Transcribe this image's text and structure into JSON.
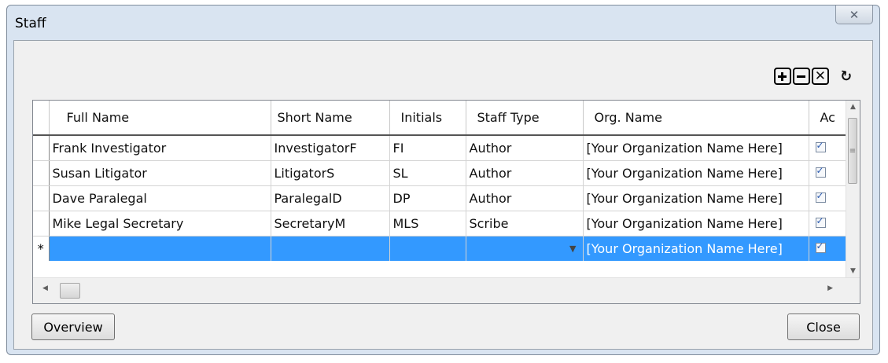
{
  "window": {
    "title": "Staff",
    "close_glyph": "✕"
  },
  "toolbar": {
    "add_icon": "plus-icon",
    "remove_icon": "minus-icon",
    "delete_icon": "x-icon",
    "refresh_icon": "refresh-icon",
    "delete_glyph": "✕",
    "refresh_glyph": "↻"
  },
  "grid": {
    "columns": [
      "Full Name",
      "Short Name",
      "Initials",
      "Staff Type",
      "Org. Name",
      "Ac"
    ],
    "rows": [
      {
        "full_name": "Frank Investigator",
        "short_name": "InvestigatorF",
        "initials": "FI",
        "staff_type": "Author",
        "org_name": "[Your Organization Name Here]",
        "active": true
      },
      {
        "full_name": "Susan Litigator",
        "short_name": "LitigatorS",
        "initials": "SL",
        "staff_type": "Author",
        "org_name": "[Your Organization Name Here]",
        "active": true
      },
      {
        "full_name": "Dave Paralegal",
        "short_name": "ParalegalD",
        "initials": "DP",
        "staff_type": "Author",
        "org_name": "[Your Organization Name Here]",
        "active": true
      },
      {
        "full_name": "Mike Legal Secretary",
        "short_name": "SecretaryM",
        "initials": "MLS",
        "staff_type": "Scribe",
        "org_name": "[Your Organization Name Here]",
        "active": true
      }
    ],
    "new_row": {
      "marker": "*",
      "full_name": "",
      "short_name": "",
      "initials": "",
      "staff_type": "",
      "org_name": "[Your Organization Name Here]",
      "active": true
    },
    "selected_row_color": "#3399ff"
  },
  "buttons": {
    "overview": "Overview",
    "close": "Close"
  }
}
